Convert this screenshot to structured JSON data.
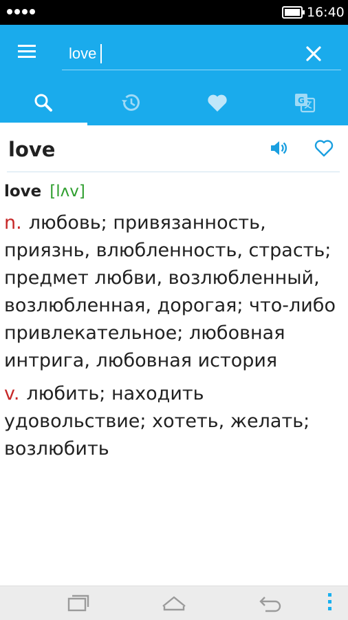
{
  "colors": {
    "accent": "#1aabec",
    "status_bar": "#000000",
    "part_of_speech": "#c62828",
    "transcription": "#2e9e2e",
    "icon_blue": "#1a9fe0",
    "nav_bar": "#ececec"
  },
  "status_bar": {
    "time": "16:40",
    "signal_dots": 4,
    "battery_level": 0.85
  },
  "search": {
    "value": "love",
    "placeholder": ""
  },
  "tabs": [
    {
      "icon": "search-icon",
      "active": true
    },
    {
      "icon": "history-icon",
      "active": false
    },
    {
      "icon": "heart-icon",
      "active": false
    },
    {
      "icon": "translate-icon",
      "active": false
    }
  ],
  "entry": {
    "headword": "love",
    "word": "love",
    "transcription": "[lʌv]",
    "senses": [
      {
        "pos": "n.",
        "text": "любовь; привязанность, приязнь, влюбленность, страсть; предмет любви, возлюбленный, возлюбленная, дорогая; что-либо привлекательное; любовная интрига, любовная история"
      },
      {
        "pos": "v.",
        "text": "любить; находить удовольствие; хотеть, желать; возлюбить"
      }
    ]
  }
}
